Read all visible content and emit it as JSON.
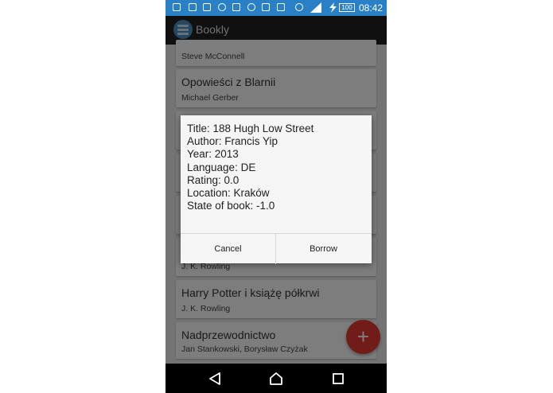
{
  "status_bar": {
    "battery": "100",
    "time": "08:42",
    "color": "#2a80c6"
  },
  "app_bar": {
    "title": "Bookly",
    "logo_icon": "books-stack-icon"
  },
  "book_list": [
    {
      "title": "",
      "author": "Steve McConnell"
    },
    {
      "title": "Opowieści z Blarnii",
      "author": "Michael Gerber"
    },
    {
      "title": "",
      "author": ""
    },
    {
      "title": "",
      "author": ""
    },
    {
      "title": "",
      "author": ""
    },
    {
      "title": "",
      "author": "J. K. Rowling"
    },
    {
      "title": "Harry Potter i książę półkrwi",
      "author": "J. K. Rowling"
    },
    {
      "title": "Nadprzewodnictwo",
      "author": "Jan Stankowski, Borysław Czyżak"
    }
  ],
  "fab": {
    "label": "+",
    "color": "#e53935"
  },
  "dialog": {
    "lines": [
      "Title: 188 Hugh Low Street",
      "Author: Francis Yip",
      "Year: 2013",
      "Language: DE",
      "Rating: 0.0",
      "Location: Kraków",
      "State of book: -1.0"
    ],
    "cancel_label": "Cancel",
    "borrow_label": "Borrow"
  },
  "nav_bar": {
    "back_icon": "back-triangle-icon",
    "home_icon": "home-circle-icon",
    "recents_icon": "recents-square-icon"
  }
}
